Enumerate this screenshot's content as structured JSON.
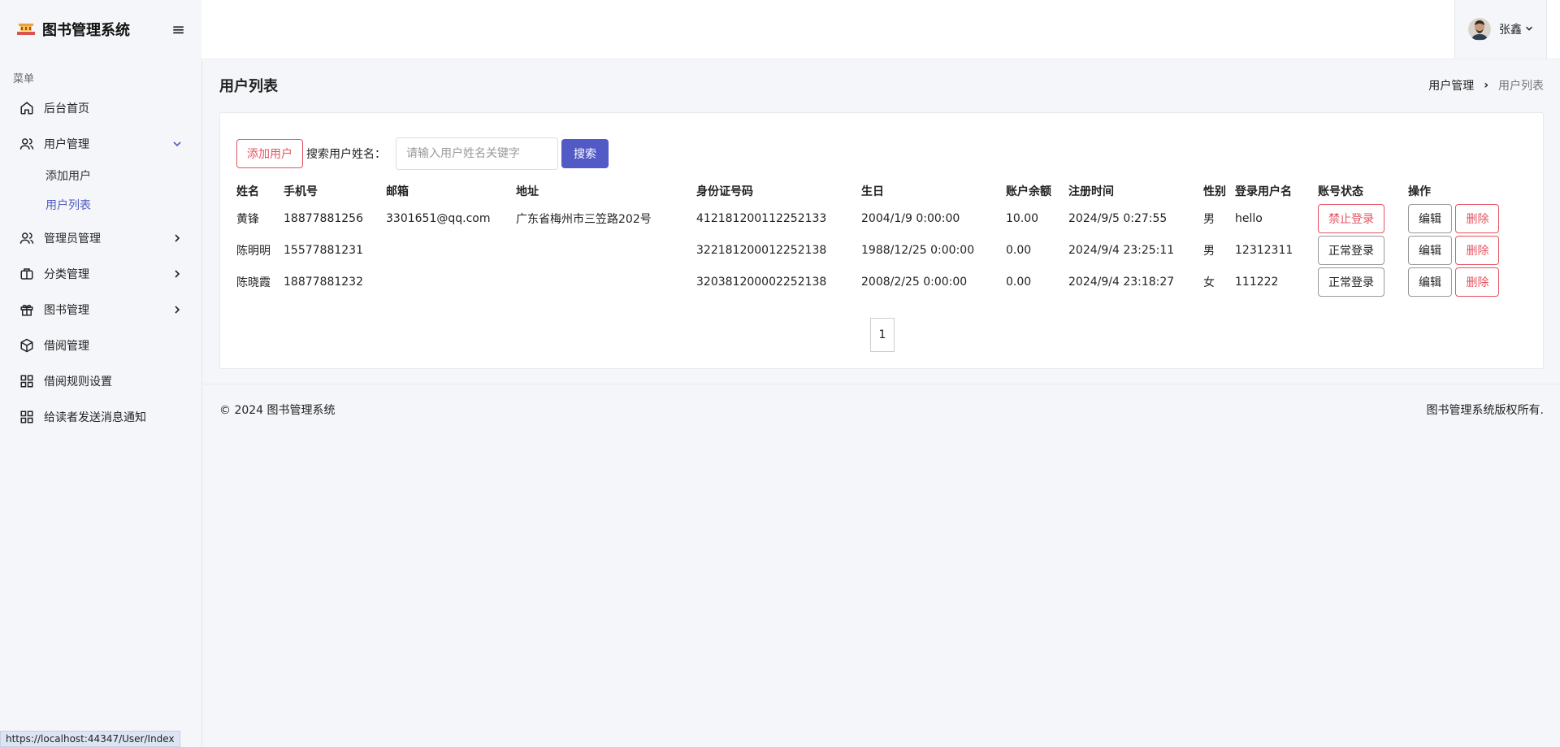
{
  "app": {
    "title": "图书管理系统"
  },
  "sidebar": {
    "menu_caption": "菜单",
    "items": [
      {
        "label": "后台首页",
        "icon": "home-icon"
      },
      {
        "label": "用户管理",
        "icon": "users-icon",
        "expanded": true,
        "children": [
          {
            "label": "添加用户"
          },
          {
            "label": "用户列表",
            "active": true
          }
        ]
      },
      {
        "label": "管理员管理",
        "icon": "users-icon"
      },
      {
        "label": "分类管理",
        "icon": "briefcase-icon"
      },
      {
        "label": "图书管理",
        "icon": "gift-icon"
      },
      {
        "label": "借阅管理",
        "icon": "box-icon"
      },
      {
        "label": "借阅规则设置",
        "icon": "grid-icon"
      },
      {
        "label": "给读者发送消息通知",
        "icon": "grid-icon"
      }
    ]
  },
  "status_bar": {
    "url": "https://localhost:44347/User/Index"
  },
  "header": {
    "user_name": "张鑫"
  },
  "page": {
    "title": "用户列表",
    "breadcrumb": {
      "parent": "用户管理",
      "current": "用户列表"
    }
  },
  "toolbar": {
    "add_label": "添加用户",
    "search_label": "搜索用户姓名：",
    "search_placeholder": "请输入用户姓名关键字",
    "search_button": "搜索"
  },
  "table": {
    "headers": [
      "姓名",
      "手机号",
      "邮箱",
      "地址",
      "身份证号码",
      "生日",
      "账户余额",
      "注册时间",
      "性别",
      "登录用户名",
      "账号状态",
      "操作"
    ],
    "rows": [
      {
        "name": "黄锋",
        "phone": "18877881256",
        "email": "3301651@qq.com",
        "address": "广东省梅州市三笠路202号",
        "id_number": "412181200112252133",
        "birthday": "2004/1/9 0:00:00",
        "balance": "10.00",
        "registered": "2024/9/5 0:27:55",
        "gender": "男",
        "username": "hello",
        "status": "禁止登录",
        "status_style": "danger"
      },
      {
        "name": "陈明明",
        "phone": "15577881231",
        "email": "",
        "address": "",
        "id_number": "322181200012252138",
        "birthday": "1988/12/25 0:00:00",
        "balance": "0.00",
        "registered": "2024/9/4 23:25:11",
        "gender": "男",
        "username": "12312311",
        "status": "正常登录",
        "status_style": "normal"
      },
      {
        "name": "陈晓霞",
        "phone": "18877881232",
        "email": "",
        "address": "",
        "id_number": "320381200002252138",
        "birthday": "2008/2/25 0:00:00",
        "balance": "0.00",
        "registered": "2024/9/4 23:18:27",
        "gender": "女",
        "username": "111222",
        "status": "正常登录",
        "status_style": "normal"
      }
    ],
    "edit_label": "编辑",
    "delete_label": "删除"
  },
  "pagination": {
    "current_page": "1"
  },
  "footer": {
    "copyright": "© 2024 图书管理系统",
    "rights": "图书管理系统版权所有."
  },
  "colors": {
    "primary": "#525ac5",
    "danger": "#e45360",
    "active_link": "#4e5ac0"
  }
}
